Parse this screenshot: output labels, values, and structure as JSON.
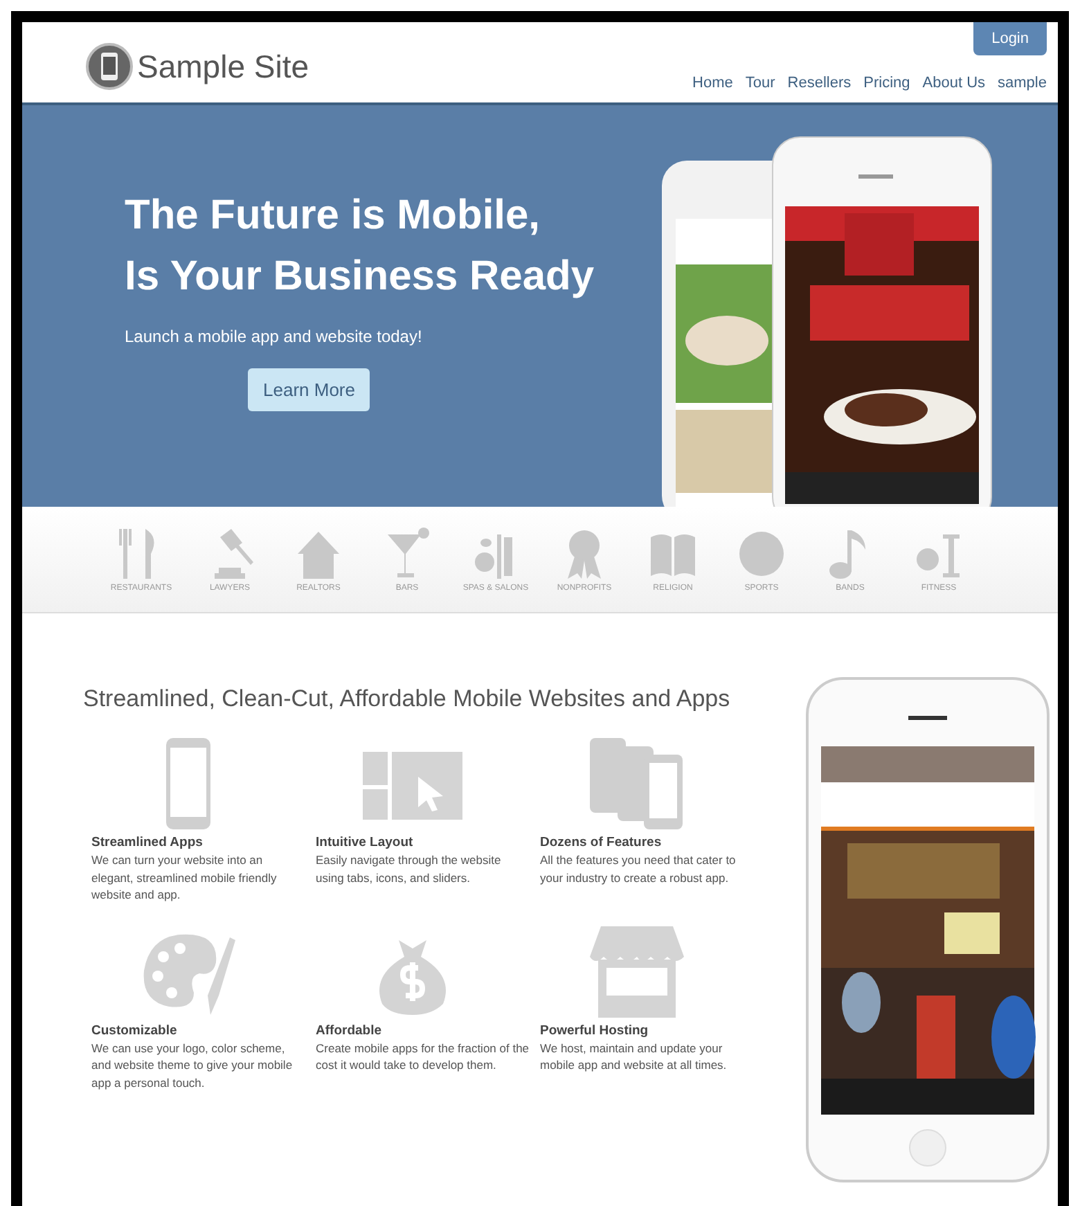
{
  "header": {
    "site_name": "Sample Site",
    "login": "Login",
    "nav": [
      {
        "label": "Home"
      },
      {
        "label": "Tour"
      },
      {
        "label": "Resellers"
      },
      {
        "label": "Pricing"
      },
      {
        "label": "About Us"
      },
      {
        "label": "sample"
      }
    ]
  },
  "hero": {
    "title_lines": [
      "The Future is Mobile,",
      "Is Your Business Ready"
    ],
    "subtitle": "Launch a mobile app and website today!",
    "button": "Learn More"
  },
  "industries": [
    {
      "label": "RESTAURANTS"
    },
    {
      "label": "LAWYERS"
    },
    {
      "label": "REALTORS"
    },
    {
      "label": "BARS"
    },
    {
      "label": "SPAS & SALONS"
    },
    {
      "label": "NONPROFITS"
    },
    {
      "label": "RELIGION"
    },
    {
      "label": "SPORTS"
    },
    {
      "label": "BANDS"
    },
    {
      "label": "FITNESS"
    }
  ],
  "features_heading": "Streamlined, Clean-Cut, Affordable Mobile Websites and Apps",
  "features": [
    {
      "title": "Streamlined Apps",
      "text": "We can turn your website into an elegant, streamlined mobile friendly website and app."
    },
    {
      "title": "Intuitive Layout",
      "text": "Easily navigate through the website using tabs, icons, and sliders."
    },
    {
      "title": "Dozens of Features",
      "text": "All the features you need that cater to your industry to create a robust app."
    },
    {
      "title": "Customizable",
      "text": "We can use your logo, color scheme, and website theme to give your mobile app a personal touch."
    },
    {
      "title": "Affordable",
      "text": "Create mobile apps for the fraction of the cost it would take to develop them."
    },
    {
      "title": "Powerful Hosting",
      "text": "We host, maintain and update your mobile app and website at all times."
    }
  ]
}
